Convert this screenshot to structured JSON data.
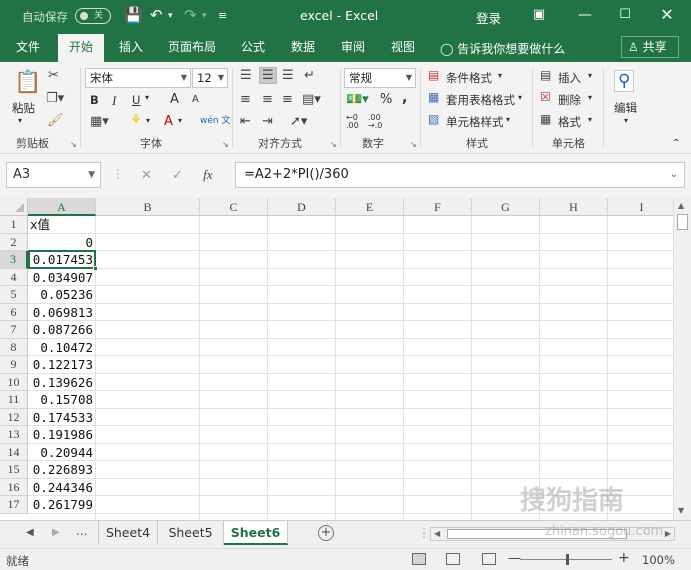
{
  "titlebar": {
    "autosave_label": "自动保存",
    "autosave_state": "关",
    "title": "excel  -  Excel",
    "login": "登录"
  },
  "tabs": [
    "文件",
    "开始",
    "插入",
    "页面布局",
    "公式",
    "数据",
    "审阅",
    "视图"
  ],
  "active_tab": "开始",
  "tell_me": "告诉我你想要做什么",
  "share": "共享",
  "ribbon": {
    "clipboard": {
      "paste": "粘贴",
      "label": "剪贴板"
    },
    "font": {
      "name": "宋体",
      "size": "12",
      "label": "字体",
      "bold": "B",
      "italic": "I",
      "underline": "U",
      "grow": "A",
      "shrink": "A",
      "wen": "wén 文"
    },
    "alignment": {
      "label": "对齐方式"
    },
    "number": {
      "format": "常规",
      "label": "数字",
      "percent": "%",
      "comma": ","
    },
    "styles": {
      "conditional": "条件格式",
      "table": "套用表格格式",
      "cell_styles": "单元格样式",
      "label": "样式"
    },
    "cells": {
      "insert": "插入",
      "delete": "删除",
      "format": "格式",
      "label": "单元格"
    },
    "editing": {
      "label": "编辑"
    }
  },
  "formula_bar": {
    "name_box": "A3",
    "fx": "fx",
    "formula": "=A2+2*PI()/360"
  },
  "grid": {
    "columns": [
      "A",
      "B",
      "C",
      "D",
      "E",
      "F",
      "G",
      "H",
      "I"
    ],
    "selected_column": "A",
    "selected_row": "3",
    "rows": [
      {
        "row": "1",
        "a": "x值",
        "type": "text"
      },
      {
        "row": "2",
        "a": "0",
        "type": "num"
      },
      {
        "row": "3",
        "a": "0.017453",
        "type": "num"
      },
      {
        "row": "4",
        "a": "0.034907",
        "type": "num"
      },
      {
        "row": "5",
        "a": "0.05236",
        "type": "num"
      },
      {
        "row": "6",
        "a": "0.069813",
        "type": "num"
      },
      {
        "row": "7",
        "a": "0.087266",
        "type": "num"
      },
      {
        "row": "8",
        "a": "0.10472",
        "type": "num"
      },
      {
        "row": "9",
        "a": "0.122173",
        "type": "num"
      },
      {
        "row": "10",
        "a": "0.139626",
        "type": "num"
      },
      {
        "row": "11",
        "a": "0.15708",
        "type": "num"
      },
      {
        "row": "12",
        "a": "0.174533",
        "type": "num"
      },
      {
        "row": "13",
        "a": "0.191986",
        "type": "num"
      },
      {
        "row": "14",
        "a": "0.20944",
        "type": "num"
      },
      {
        "row": "15",
        "a": "0.226893",
        "type": "num"
      },
      {
        "row": "16",
        "a": "0.244346",
        "type": "num"
      },
      {
        "row": "17",
        "a": "0.261799",
        "type": "num"
      }
    ]
  },
  "sheets": [
    "Sheet4",
    "Sheet5",
    "Sheet6"
  ],
  "active_sheet": "Sheet6",
  "sheet_more": "...",
  "status": {
    "ready": "就绪",
    "zoom": "100%"
  },
  "watermark": {
    "brand": "搜狗指南",
    "url": "zhinan.sogou.com"
  },
  "colors": {
    "brand": "#217346",
    "ribbon_bg": "#f3f3f3"
  }
}
